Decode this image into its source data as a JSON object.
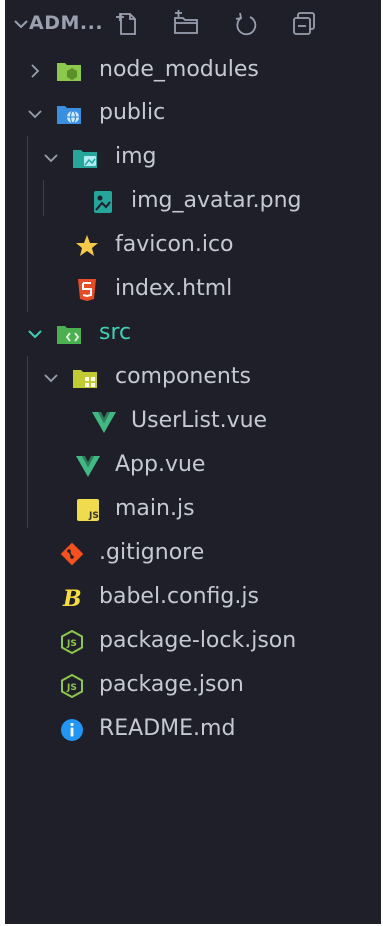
{
  "header": {
    "title": "ADM...",
    "actions": [
      "new-file-icon",
      "new-folder-icon",
      "refresh-icon",
      "collapse-all-icon"
    ]
  },
  "tree": {
    "node_modules": "node_modules",
    "public": "public",
    "img": "img",
    "img_avatar": "img_avatar.png",
    "favicon": "favicon.ico",
    "index_html": "index.html",
    "src": "src",
    "components": "components",
    "userlist": "UserList.vue",
    "app_vue": "App.vue",
    "main_js": "main.js",
    "gitignore": ".gitignore",
    "babel_config": "babel.config.js",
    "package_lock": "package-lock.json",
    "package_json": "package.json",
    "readme": "README.md"
  },
  "colors": {
    "background": "#1e1f29",
    "text": "#c6c9d2",
    "active_folder": "#3fd1b4",
    "vue_green": "#41b883",
    "node_green": "#8cc84b",
    "html_orange": "#e44d26",
    "js_yellow": "#f0db4f",
    "info_blue": "#2196f3"
  }
}
